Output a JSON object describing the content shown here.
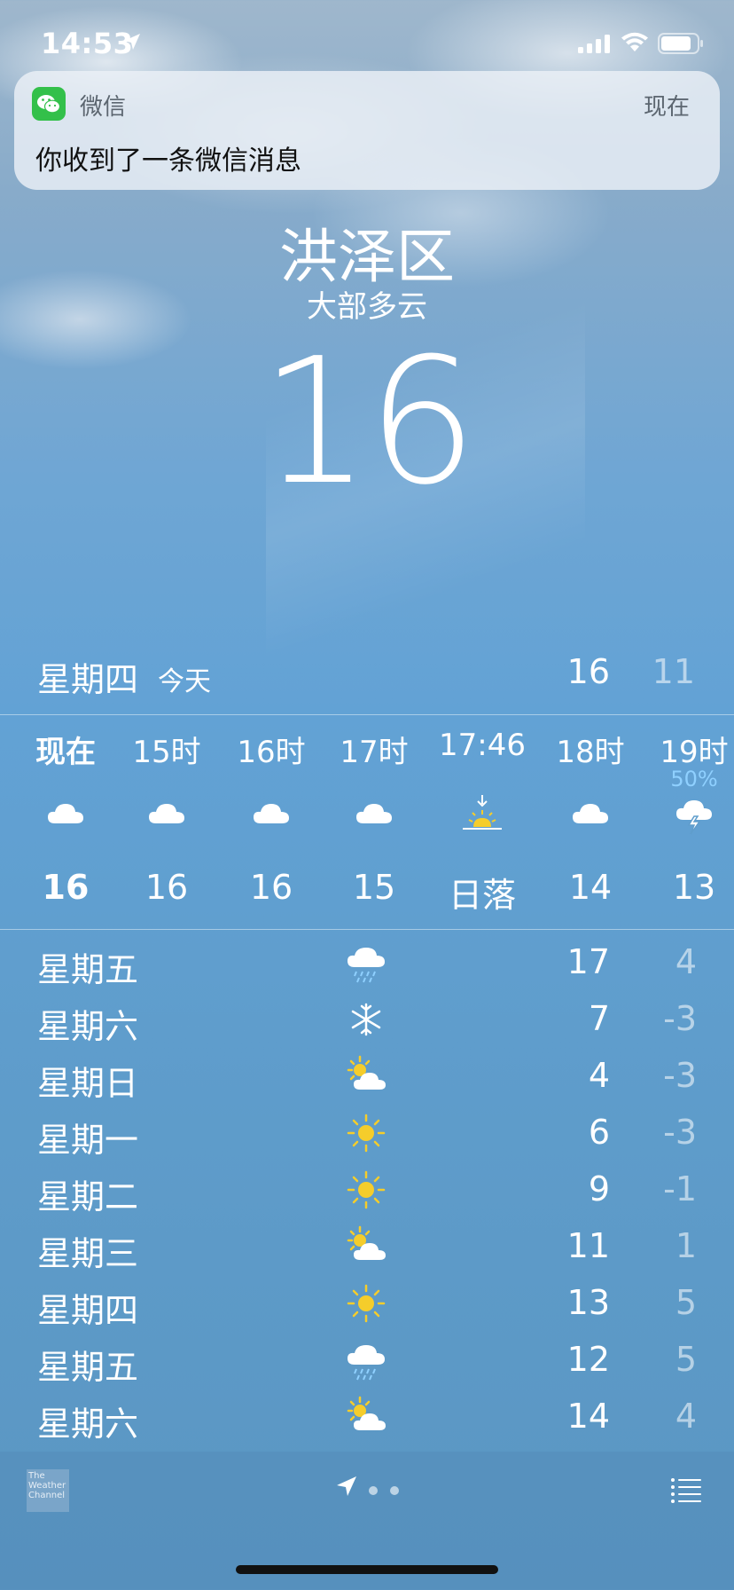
{
  "status_bar": {
    "time": "14:53"
  },
  "notification": {
    "app": "微信",
    "when": "现在",
    "message": "你收到了一条微信消息"
  },
  "header": {
    "city": "洪泽区",
    "condition": "大部多云",
    "temperature": "16"
  },
  "today": {
    "day": "星期四",
    "label": "今天",
    "high": "16",
    "low": "11"
  },
  "hourly": [
    {
      "time": "现在",
      "icon": "cloud-icon",
      "temp": "16",
      "precip": ""
    },
    {
      "time": "15时",
      "icon": "cloud-icon",
      "temp": "16",
      "precip": ""
    },
    {
      "time": "16时",
      "icon": "cloud-icon",
      "temp": "16",
      "precip": ""
    },
    {
      "time": "17时",
      "icon": "cloud-icon",
      "temp": "15",
      "precip": ""
    },
    {
      "time": "17:46",
      "icon": "sunset-icon",
      "temp": "日落",
      "precip": ""
    },
    {
      "time": "18时",
      "icon": "cloud-icon",
      "temp": "14",
      "precip": ""
    },
    {
      "time": "19时",
      "icon": "thunderstorm-icon",
      "temp": "13",
      "precip": "50%"
    }
  ],
  "daily": [
    {
      "day": "星期五",
      "icon": "rain-icon",
      "high": "17",
      "low": "4"
    },
    {
      "day": "星期六",
      "icon": "snow-icon",
      "high": "7",
      "low": "-3"
    },
    {
      "day": "星期日",
      "icon": "partly-cloudy-icon",
      "high": "4",
      "low": "-3"
    },
    {
      "day": "星期一",
      "icon": "sun-icon",
      "high": "6",
      "low": "-3"
    },
    {
      "day": "星期二",
      "icon": "sun-icon",
      "high": "9",
      "low": "-1"
    },
    {
      "day": "星期三",
      "icon": "partly-cloudy-icon",
      "high": "11",
      "low": "1"
    },
    {
      "day": "星期四",
      "icon": "sun-icon",
      "high": "13",
      "low": "5"
    },
    {
      "day": "星期五",
      "icon": "rain-icon",
      "high": "12",
      "low": "5"
    },
    {
      "day": "星期六",
      "icon": "partly-cloudy-icon",
      "high": "14",
      "low": "4"
    }
  ],
  "toolbar": {
    "logo_text": "The Weather Channel"
  },
  "colors": {
    "sun": "#f5cd2b",
    "precip_text": "#8fd0ff",
    "wechat": "#33c04a"
  }
}
